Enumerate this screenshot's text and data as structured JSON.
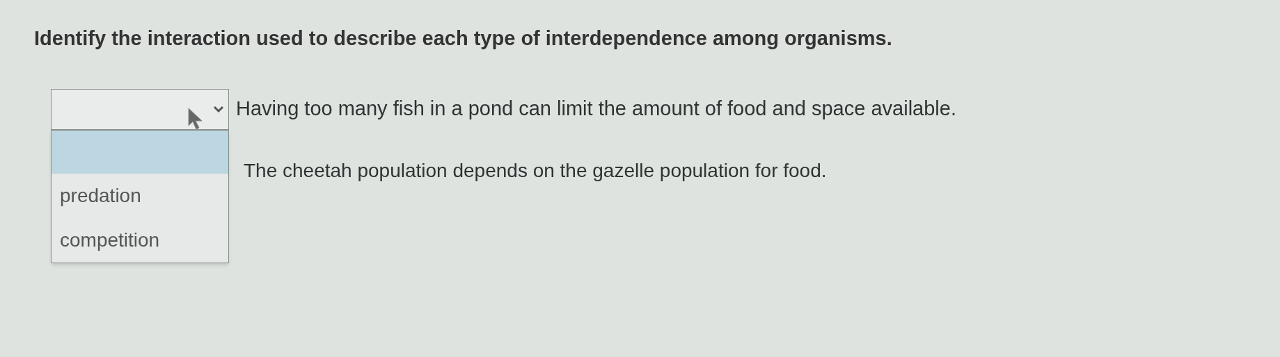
{
  "instruction": "Identify the interaction used to describe each type of interdependence among organisms.",
  "items": [
    {
      "statement": "Having too many fish in a pond can limit the amount of food and space available.",
      "dropdown": {
        "expanded": true,
        "empty_option": {
          "selected": true
        },
        "options": [
          {
            "label": "predation",
            "selected": false
          },
          {
            "label": "competition",
            "selected": false
          }
        ]
      }
    },
    {
      "statement": "The cheetah population depends on the gazelle population for food."
    }
  ]
}
